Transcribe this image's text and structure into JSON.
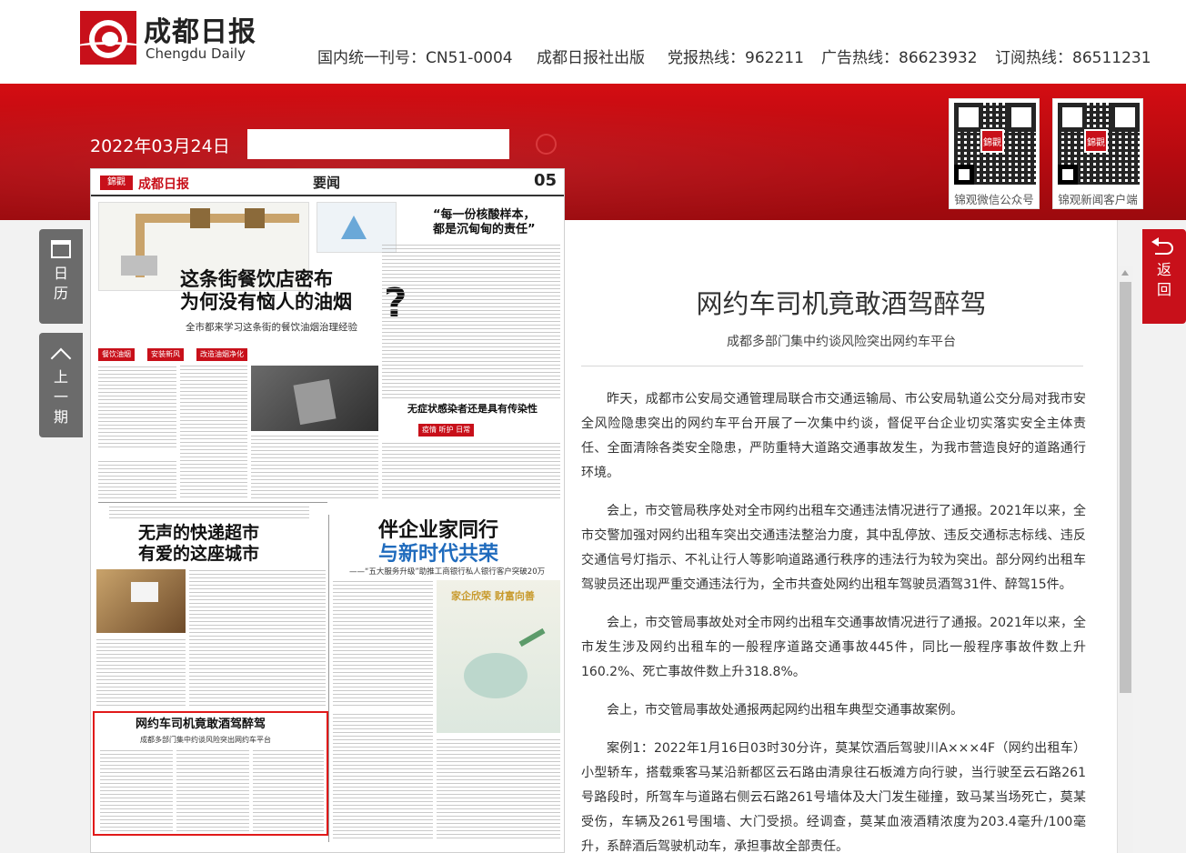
{
  "header": {
    "logo_title": "成都日报",
    "logo_subtitle": "Chengdu Daily",
    "info": [
      "国内统一刊号：CN51-0004",
      "成都日报社出版",
      "党报热线：962211",
      "广告热线：86623932",
      "订阅热线：86511231"
    ]
  },
  "toolbar": {
    "date": "2022年03月24日",
    "search_value": ""
  },
  "qr_codes": [
    {
      "badge": "錦觀",
      "label": "锦观微信公众号"
    },
    {
      "badge": "錦觀",
      "label": "锦观新闻客户端"
    }
  ],
  "side": {
    "calendar": [
      "日",
      "历"
    ],
    "prev_issue": [
      "上",
      "一",
      "期"
    ],
    "back": [
      "返",
      "回"
    ]
  },
  "paper": {
    "logo": "錦觀",
    "name": "成都日报",
    "section": "要闻",
    "page_num": "05",
    "headlines": {
      "oil_smoke_1": "这条街餐饮店密布",
      "oil_smoke_2": "为何没有恼人的油烟",
      "oil_smoke_sub": "全市都来学习这条街的餐饮油烟治理经验",
      "test_1": "“每一份核酸样本，",
      "test_2": "都是沉甸甸的责任”",
      "infection": "无症状感染者还是具有传染性",
      "express_1": "无声的快递超市",
      "express_2": "有爱的这座城市",
      "enterprise_1": "伴企业家同行",
      "enterprise_2": "与新时代共荣",
      "enterprise_sub": "——“五大服务升级”助推工商银行私人银行客户突破20万",
      "article_title": "网约车司机竟敢酒驾醉驾",
      "article_sub": "成都多部门集中约谈风险突出网约车平台",
      "ad_title": "家企欣荣 财富向善"
    }
  },
  "article": {
    "title": "网约车司机竟敢酒驾醉驾",
    "subtitle": "成都多部门集中约谈风险突出网约车平台",
    "paragraphs": [
      "昨天，成都市公安局交通管理局联合市交通运输局、市公安局轨道公交分局对我市安全风险隐患突出的网约车平台开展了一次集中约谈，督促平台企业切实落实安全主体责任、全面清除各类安全隐患，严防重特大道路交通事故发生，为我市营造良好的道路通行环境。",
      "会上，市交管局秩序处对全市网约出租车交通违法情况进行了通报。2021年以来，全市交警加强对网约出租车突出交通违法整治力度，其中乱停放、违反交通标志标线、违反交通信号灯指示、不礼让行人等影响道路通行秩序的违法行为较为突出。部分网约出租车驾驶员还出现严重交通违法行为，全市共查处网约出租车驾驶员酒驾31件、醉驾15件。",
      "会上，市交管局事故处对全市网约出租车交通事故情况进行了通报。2021年以来，全市发生涉及网约出租车的一般程序道路交通事故445件，同比一般程序事故件数上升160.2%、死亡事故件数上升318.8%。",
      "会上，市交管局事故处通报两起网约出租车典型交通事故案例。",
      "案例1：2022年1月16日03时30分许，莫某饮酒后驾驶川A×××4F（网约出租车）小型轿车，搭载乘客马某沿新都区云石路由清泉往石板滩方向行驶，当行驶至云石路261号路段时，所驾车与道路右侧云石路261号墙体及大门发生碰撞，致马某当场死亡，莫某受伤，车辆及261号围墙、大门受损。经调查，莫某血液酒精浓度为203.4毫升/100毫升，系醉酒后驾驶机动车，承担事故全部责任。"
    ]
  }
}
